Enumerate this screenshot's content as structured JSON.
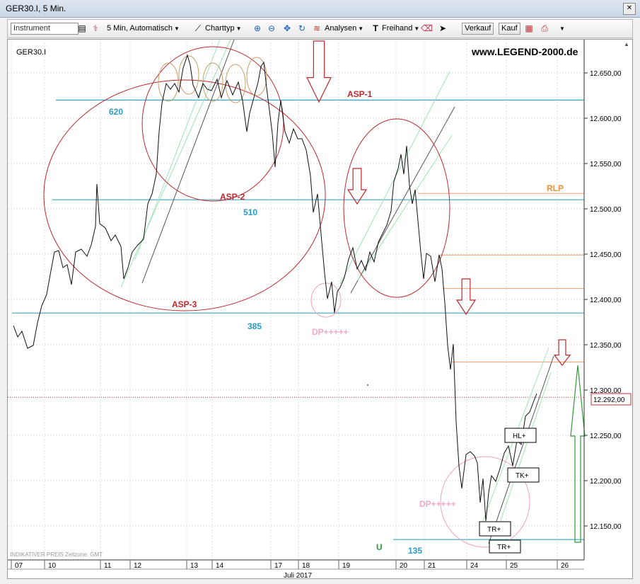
{
  "window": {
    "title": "GER30.I, 5 Min.",
    "close_label": "✕"
  },
  "toolbar": {
    "instrument_placeholder": "Instrument",
    "interval_label": "5 Min,  Automatisch",
    "charttype_label": "Charttyp",
    "analysen_label": "Analysen",
    "freihand_label": "Freihand",
    "verkauf_label": "Verkauf",
    "kauf_label": "Kauf"
  },
  "chart": {
    "symbol": "GER30.I",
    "watermark": "www.LEGEND-2000.de",
    "footer_note": "INDIKATIVER PREIS   Zeitzone: GMT",
    "month_label": "Juli 2017",
    "current_price_label": "12.292,00",
    "colors": {
      "cyan_line": "#3aa6c9",
      "orange_line": "#e8a070",
      "red_annot": "#c0282d",
      "green_channel": "#9ee3b8",
      "pink": "#eea2c0"
    },
    "price_ticks": [
      {
        "price": 12650,
        "label": "12.650,00"
      },
      {
        "price": 12600,
        "label": "12.600,00"
      },
      {
        "price": 12550,
        "label": "12.550,00"
      },
      {
        "price": 12500,
        "label": "12.500,00"
      },
      {
        "price": 12450,
        "label": "12.450,00"
      },
      {
        "price": 12400,
        "label": "12.400,00"
      },
      {
        "price": 12350,
        "label": "12.350,00"
      },
      {
        "price": 12300,
        "label": "12.300,00"
      },
      {
        "price": 12250,
        "label": "12.250,00"
      },
      {
        "price": 12200,
        "label": "12.200,00"
      },
      {
        "price": 12150,
        "label": "12.150,00"
      }
    ],
    "date_ticks": [
      "07",
      "10",
      "11",
      "12",
      "13",
      "14",
      "17",
      "18",
      "19",
      "20",
      "21",
      "24",
      "25",
      "26"
    ],
    "annotations": {
      "asp1": "ASP-1",
      "asp2": "ASP-2",
      "asp3": "ASP-3",
      "rlp": "RLP",
      "l620": "620",
      "l510": "510",
      "l385": "385",
      "l135": "135",
      "u": "U",
      "dp1": "DP+++++",
      "dp2": "DP+++++",
      "hl": "HL+",
      "tk": "TK+",
      "tr1": "TR+",
      "tr2": "TR+"
    }
  }
}
